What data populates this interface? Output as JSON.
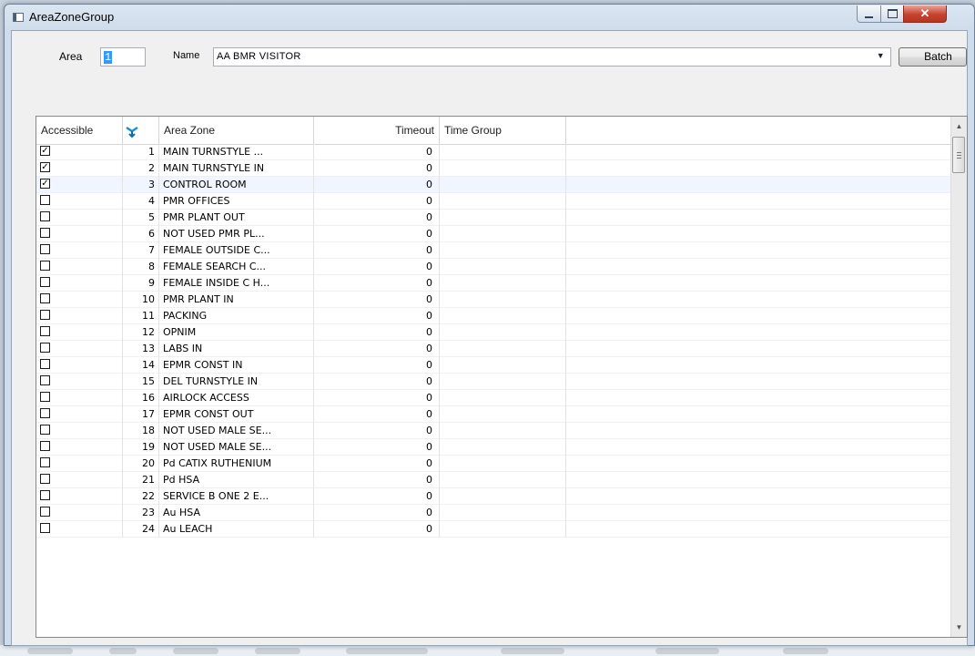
{
  "window": {
    "title": "AreaZoneGroup"
  },
  "controls": {
    "area_label": "Area",
    "area_value": "1",
    "name_label": "Name",
    "name_value": "AA BMR VISITOR",
    "batch_label": "Batch"
  },
  "grid": {
    "columns": {
      "accessible": "Accessible",
      "area_zone": "Area Zone",
      "timeout": "Timeout",
      "time_group": "Time Group"
    },
    "rows": [
      {
        "checked": true,
        "num": "1",
        "zone": "MAIN TURNSTYLE ...",
        "timeout": "0",
        "time_group": ""
      },
      {
        "checked": true,
        "num": "2",
        "zone": "MAIN TURNSTYLE IN",
        "timeout": "0",
        "time_group": ""
      },
      {
        "checked": true,
        "num": "3",
        "zone": "CONTROL ROOM",
        "timeout": "0",
        "time_group": ""
      },
      {
        "checked": false,
        "num": "4",
        "zone": "PMR OFFICES",
        "timeout": "0",
        "time_group": ""
      },
      {
        "checked": false,
        "num": "5",
        "zone": "PMR PLANT  OUT",
        "timeout": "0",
        "time_group": ""
      },
      {
        "checked": false,
        "num": "6",
        "zone": "NOT USED PMR PL...",
        "timeout": "0",
        "time_group": ""
      },
      {
        "checked": false,
        "num": "7",
        "zone": "FEMALE OUTSIDE C...",
        "timeout": "0",
        "time_group": ""
      },
      {
        "checked": false,
        "num": "8",
        "zone": "FEMALE SEARCH C...",
        "timeout": "0",
        "time_group": ""
      },
      {
        "checked": false,
        "num": "9",
        "zone": "FEMALE INSIDE C H...",
        "timeout": "0",
        "time_group": ""
      },
      {
        "checked": false,
        "num": "10",
        "zone": "PMR PLANT IN",
        "timeout": "0",
        "time_group": ""
      },
      {
        "checked": false,
        "num": "11",
        "zone": "PACKING",
        "timeout": "0",
        "time_group": ""
      },
      {
        "checked": false,
        "num": "12",
        "zone": "OPNIM",
        "timeout": "0",
        "time_group": ""
      },
      {
        "checked": false,
        "num": "13",
        "zone": "LABS IN",
        "timeout": "0",
        "time_group": ""
      },
      {
        "checked": false,
        "num": "14",
        "zone": "EPMR CONST IN",
        "timeout": "0",
        "time_group": ""
      },
      {
        "checked": false,
        "num": "15",
        "zone": "DEL TURNSTYLE IN",
        "timeout": "0",
        "time_group": ""
      },
      {
        "checked": false,
        "num": "16",
        "zone": "AIRLOCK ACCESS",
        "timeout": "0",
        "time_group": ""
      },
      {
        "checked": false,
        "num": "17",
        "zone": "EPMR CONST OUT",
        "timeout": "0",
        "time_group": ""
      },
      {
        "checked": false,
        "num": "18",
        "zone": "NOT USED MALE SE...",
        "timeout": "0",
        "time_group": ""
      },
      {
        "checked": false,
        "num": "19",
        "zone": "NOT USED MALE SE...",
        "timeout": "0",
        "time_group": ""
      },
      {
        "checked": false,
        "num": "20",
        "zone": "Pd CATIX RUTHENIUM",
        "timeout": "0",
        "time_group": ""
      },
      {
        "checked": false,
        "num": "21",
        "zone": "Pd HSA",
        "timeout": "0",
        "time_group": ""
      },
      {
        "checked": false,
        "num": "22",
        "zone": "SERVICE B ONE 2 E...",
        "timeout": "0",
        "time_group": ""
      },
      {
        "checked": false,
        "num": "23",
        "zone": "Au HSA",
        "timeout": "0",
        "time_group": ""
      },
      {
        "checked": false,
        "num": "24",
        "zone": "Au LEACH",
        "timeout": "0",
        "time_group": ""
      }
    ]
  }
}
